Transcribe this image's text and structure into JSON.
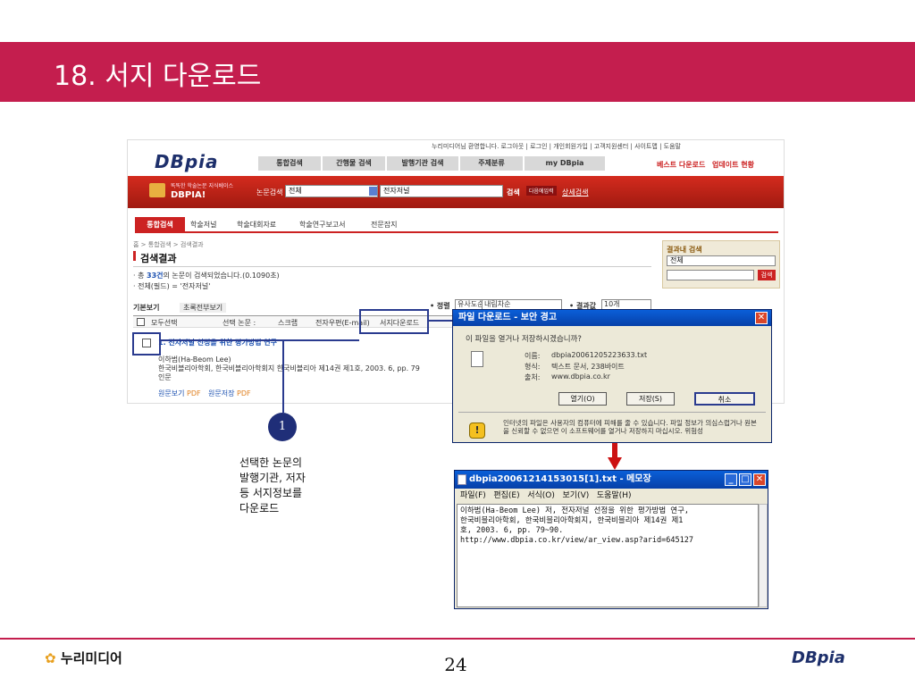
{
  "slide": {
    "title": "18. 서지 다운로드",
    "page_number": "24"
  },
  "site": {
    "top_links": "누리미디어님 환영합니다.  로그아웃  |  로그인  |  개인회원가입  |  고객지원센터  |  사이트맵  |  도움말",
    "logo": "DBpia",
    "nav_tabs": [
      "통합검색",
      "간행물 검색",
      "발행기관 검색",
      "주제분류",
      "my DBpia"
    ],
    "nav_right": [
      "베스트 다운로드",
      "업데이트 현황"
    ],
    "banner_slogan_1": "똑똑한 학술논문 지식베이스",
    "banner_slogan_2": "DBPIA!",
    "search_label": "논문검색",
    "search_scope": "전체",
    "search_query": "전자저널",
    "search_button": "검색",
    "search_in_results": "다음에입력",
    "advanced_search": "상세검색"
  },
  "subtabs": [
    "통합검색",
    "학술저널",
    "학술대회자료",
    "학술연구보고서",
    "전문잡지"
  ],
  "breadcrumb": "홈 > 통합검색 > 검색결과",
  "results": {
    "heading": "검색결과",
    "summary_prefix": "· 총 ",
    "summary_count": "33건",
    "summary_suffix": "의 논문이 검색되었습니다.(0.1090초)",
    "filter": "· 전체(필드) = '전자저널'"
  },
  "side_search": {
    "title": "결과내 검색",
    "scope": "전체",
    "button": "검색"
  },
  "sort": {
    "label": "• 정렬",
    "option_1": "유사도순",
    "option_2": "내림차순",
    "count_label": "• 결과값",
    "count_value": "10개"
  },
  "result_tabs": [
    "기본보기",
    "초록전부보기"
  ],
  "toolbar": {
    "select_all": "모두선택",
    "selected_items": "선택 논문 :",
    "scrap": "스크랩",
    "email": "전자우편(E-mail)",
    "export": "서지다운로드"
  },
  "item": {
    "title": "1. 전자저널 선정을 위한 평가방법 연구",
    "author": "이하범(Ha-Beom Lee)",
    "source": "한국비블리아학회, 한국비블리아학회지 한국비블리아 제14권 제1호, 2003. 6, pp. 79",
    "type": "인문",
    "view_label": "원문보기",
    "save_label": "원문저장",
    "format": "PDF"
  },
  "dialog": {
    "title": "파일 다운로드 - 보안 경고",
    "question": "이 파일을 열거나 저장하시겠습니까?",
    "name_label": "이름:",
    "name_value": "dbpia20061205223633.txt",
    "type_label": "형식:",
    "type_value": "텍스트 문서, 238바이트",
    "from_label": "출처:",
    "from_value": "www.dbpia.co.kr",
    "open": "열기(O)",
    "save": "저장(S)",
    "cancel": "취소",
    "warning": "인터넷의 파일은 사용자의 컴퓨터에 피해를 줄 수 있습니다. 파일 정보가 의심스럽거나 원본을 신뢰할 수 없으면 이 소프트웨어를 열거나 저장하지 마십시오. 위험성"
  },
  "notepad": {
    "title": "dbpia20061214153015[1].txt - 메모장",
    "menu": [
      "파일(F)",
      "편집(E)",
      "서식(O)",
      "보기(V)",
      "도움말(H)"
    ],
    "content": "이하범(Ha-Beom Lee) 저, 전자저널 선정을 위한 평가방법 연구,\n한국비블리아학회, 한국비블리아학회지, 한국비블리아 제14권 제1\n호, 2003. 6, pp. 79~90.\nhttp://www.dbpia.co.kr/view/ar_view.asp?arid=645127"
  },
  "callout": {
    "number": "1",
    "text": "선택한 논문의\n발행기관, 저자\n등 서지정보를\n다운로드"
  },
  "footer": {
    "brand_left": "누리미디어",
    "brand_right": "DBpia"
  },
  "colors": {
    "accent": "#c41e4e",
    "annotation": "#2a3b8f"
  }
}
